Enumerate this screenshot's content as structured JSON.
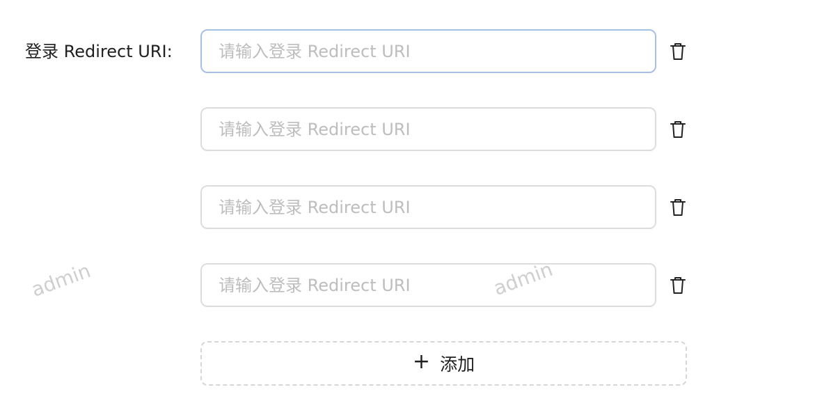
{
  "form": {
    "label": "登录 Redirect URI",
    "label_suffix": ":",
    "placeholder": "请输入登录 Redirect URI",
    "rows": [
      {
        "value": "",
        "focused": true
      },
      {
        "value": "",
        "focused": false
      },
      {
        "value": "",
        "focused": false
      },
      {
        "value": "",
        "focused": false
      }
    ],
    "add_button": {
      "icon": "plus-icon",
      "label": "添加"
    },
    "delete_icon": "trash-icon"
  },
  "watermark": {
    "text": "admin"
  },
  "colors": {
    "focus_border": "#a6bfe8",
    "border": "#dcdcdc",
    "placeholder": "#bdbdbd",
    "text": "#1f1f1f"
  }
}
